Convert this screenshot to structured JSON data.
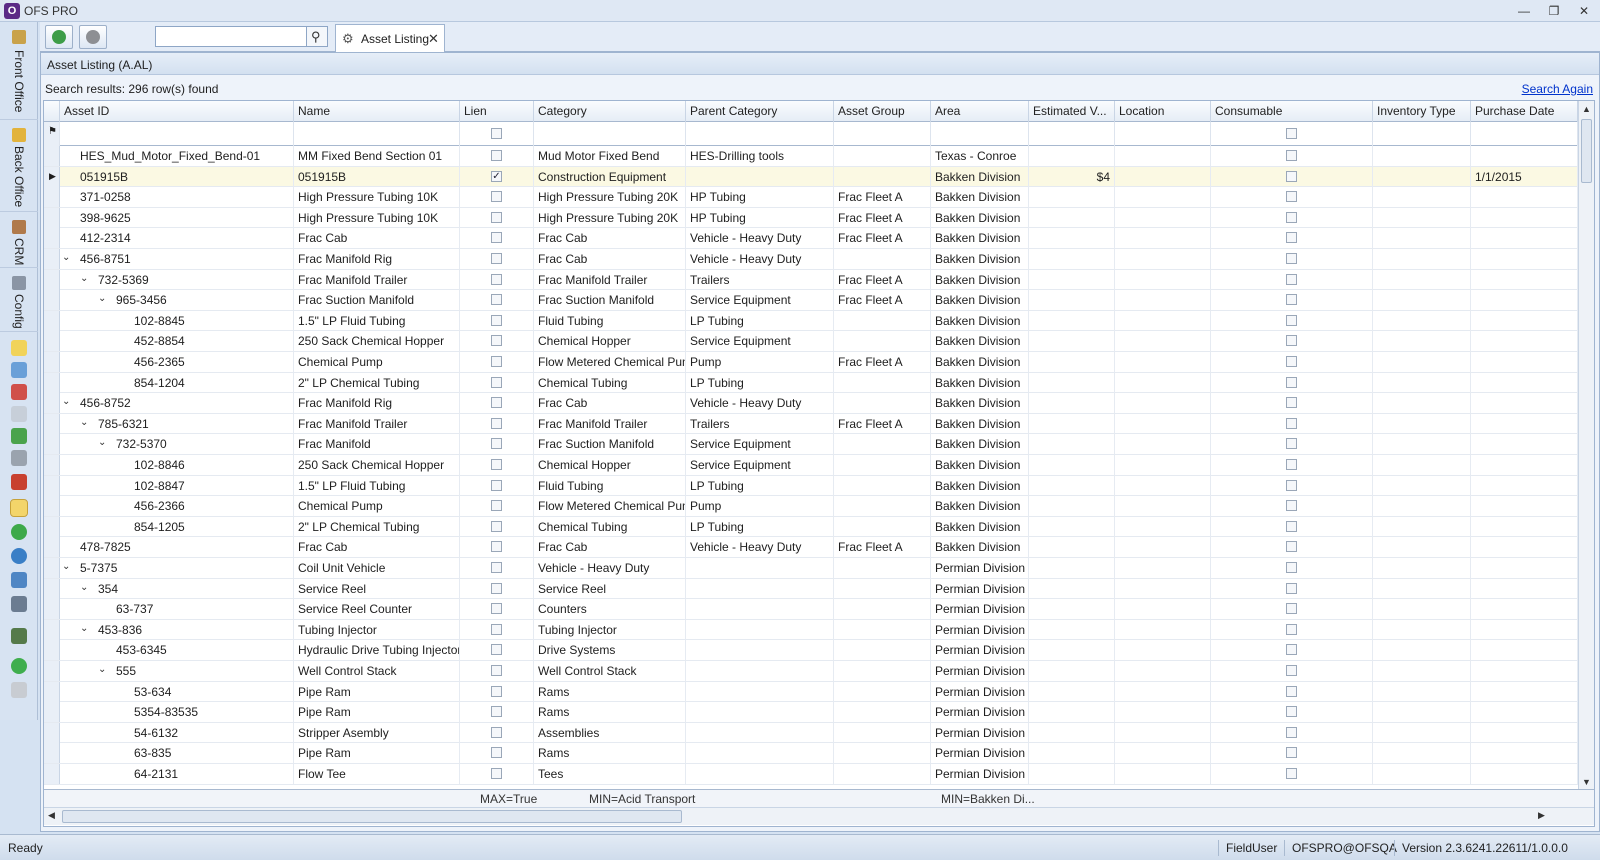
{
  "app": {
    "title": "OFS PRO"
  },
  "toolbar": {
    "search_value": "",
    "tab_label": "Asset Listing"
  },
  "panel": {
    "title": "Asset Listing (A.AL)",
    "results": "Search results: 296 row(s) found",
    "search_again": "Search Again"
  },
  "columns": [
    "Asset ID",
    "Name",
    "Lien",
    "Category",
    "Parent Category",
    "Asset Group",
    "Area",
    "Estimated V...",
    "Location",
    "Consumable",
    "Inventory Type",
    "Purchase Date"
  ],
  "rows": [
    {
      "id": "HES_Mud_Motor_Fixed_Bend-01",
      "lvl": 0,
      "exp": "",
      "name": "MM Fixed Bend Section 01",
      "lien": false,
      "cat": "Mud Motor Fixed Bend",
      "pcat": "HES-Drilling tools",
      "grp": "",
      "area": "Texas - Conroe",
      "est": "",
      "date": ""
    },
    {
      "id": "051915B",
      "lvl": 0,
      "exp": "",
      "name": "051915B",
      "lien": true,
      "cat": "Construction Equipment",
      "pcat": "",
      "grp": "",
      "area": "Bakken Division",
      "est": "$4",
      "date": "1/1/2015",
      "sel": true
    },
    {
      "id": "371-0258",
      "lvl": 0,
      "exp": "",
      "name": "High Pressure Tubing 10K",
      "lien": false,
      "cat": "High Pressure Tubing 20K",
      "pcat": "HP Tubing",
      "grp": "Frac Fleet A",
      "area": "Bakken Division",
      "est": "",
      "date": ""
    },
    {
      "id": "398-9625",
      "lvl": 0,
      "exp": "",
      "name": "High Pressure Tubing 10K",
      "lien": false,
      "cat": "High Pressure Tubing 20K",
      "pcat": "HP Tubing",
      "grp": "Frac Fleet A",
      "area": "Bakken Division",
      "est": "",
      "date": ""
    },
    {
      "id": "412-2314",
      "lvl": 0,
      "exp": "",
      "name": "Frac Cab",
      "lien": false,
      "cat": "Frac Cab",
      "pcat": "Vehicle - Heavy Duty",
      "grp": "Frac Fleet A",
      "area": "Bakken Division",
      "est": "",
      "date": ""
    },
    {
      "id": "456-8751",
      "lvl": 0,
      "exp": "⌄",
      "name": "Frac Manifold Rig",
      "lien": false,
      "cat": "Frac Cab",
      "pcat": "Vehicle - Heavy Duty",
      "grp": "",
      "area": "Bakken Division",
      "est": "",
      "date": ""
    },
    {
      "id": "732-5369",
      "lvl": 1,
      "exp": "⌄",
      "name": "Frac Manifold Trailer",
      "lien": false,
      "cat": "Frac Manifold Trailer",
      "pcat": "Trailers",
      "grp": "Frac Fleet A",
      "area": "Bakken Division",
      "est": "",
      "date": ""
    },
    {
      "id": "965-3456",
      "lvl": 2,
      "exp": "⌄",
      "name": "Frac Suction Manifold",
      "lien": false,
      "cat": "Frac Suction Manifold",
      "pcat": "Service Equipment",
      "grp": "Frac Fleet A",
      "area": "Bakken Division",
      "est": "",
      "date": ""
    },
    {
      "id": "102-8845",
      "lvl": 3,
      "exp": "",
      "name": "1.5\" LP Fluid Tubing",
      "lien": false,
      "cat": "Fluid Tubing",
      "pcat": "LP Tubing",
      "grp": "",
      "area": "Bakken Division",
      "est": "",
      "date": ""
    },
    {
      "id": "452-8854",
      "lvl": 3,
      "exp": "",
      "name": "250 Sack Chemical Hopper",
      "lien": false,
      "cat": "Chemical Hopper",
      "pcat": "Service Equipment",
      "grp": "",
      "area": "Bakken Division",
      "est": "",
      "date": ""
    },
    {
      "id": "456-2365",
      "lvl": 3,
      "exp": "",
      "name": "Chemical Pump",
      "lien": false,
      "cat": "Flow Metered Chemical Pump",
      "pcat": "Pump",
      "grp": "Frac Fleet A",
      "area": "Bakken Division",
      "est": "",
      "date": ""
    },
    {
      "id": "854-1204",
      "lvl": 3,
      "exp": "",
      "name": "2\" LP Chemical Tubing",
      "lien": false,
      "cat": "Chemical Tubing",
      "pcat": "LP Tubing",
      "grp": "",
      "area": "Bakken Division",
      "est": "",
      "date": ""
    },
    {
      "id": "456-8752",
      "lvl": 0,
      "exp": "⌄",
      "name": "Frac Manifold Rig",
      "lien": false,
      "cat": "Frac Cab",
      "pcat": "Vehicle - Heavy Duty",
      "grp": "",
      "area": "Bakken Division",
      "est": "",
      "date": ""
    },
    {
      "id": "785-6321",
      "lvl": 1,
      "exp": "⌄",
      "name": "Frac Manifold Trailer",
      "lien": false,
      "cat": "Frac Manifold Trailer",
      "pcat": "Trailers",
      "grp": "Frac Fleet A",
      "area": "Bakken Division",
      "est": "",
      "date": ""
    },
    {
      "id": "732-5370",
      "lvl": 2,
      "exp": "⌄",
      "name": "Frac Manifold",
      "lien": false,
      "cat": "Frac Suction Manifold",
      "pcat": "Service Equipment",
      "grp": "",
      "area": "Bakken Division",
      "est": "",
      "date": ""
    },
    {
      "id": "102-8846",
      "lvl": 3,
      "exp": "",
      "name": "250 Sack Chemical Hopper",
      "lien": false,
      "cat": "Chemical Hopper",
      "pcat": "Service Equipment",
      "grp": "",
      "area": "Bakken Division",
      "est": "",
      "date": ""
    },
    {
      "id": "102-8847",
      "lvl": 3,
      "exp": "",
      "name": "1.5\" LP Fluid Tubing",
      "lien": false,
      "cat": "Fluid Tubing",
      "pcat": "LP Tubing",
      "grp": "",
      "area": "Bakken Division",
      "est": "",
      "date": ""
    },
    {
      "id": "456-2366",
      "lvl": 3,
      "exp": "",
      "name": "Chemical Pump",
      "lien": false,
      "cat": "Flow Metered Chemical Pump",
      "pcat": "Pump",
      "grp": "",
      "area": "Bakken Division",
      "est": "",
      "date": ""
    },
    {
      "id": "854-1205",
      "lvl": 3,
      "exp": "",
      "name": "2\" LP Chemical Tubing",
      "lien": false,
      "cat": "Chemical Tubing",
      "pcat": "LP Tubing",
      "grp": "",
      "area": "Bakken Division",
      "est": "",
      "date": ""
    },
    {
      "id": "478-7825",
      "lvl": 0,
      "exp": "",
      "name": "Frac Cab",
      "lien": false,
      "cat": "Frac Cab",
      "pcat": "Vehicle - Heavy Duty",
      "grp": "Frac Fleet A",
      "area": "Bakken Division",
      "est": "",
      "date": ""
    },
    {
      "id": "5-7375",
      "lvl": 0,
      "exp": "⌄",
      "name": "Coil Unit Vehicle",
      "lien": false,
      "cat": "Vehicle - Heavy Duty",
      "pcat": "",
      "grp": "",
      "area": "Permian Division",
      "est": "",
      "date": ""
    },
    {
      "id": "354",
      "lvl": 1,
      "exp": "⌄",
      "name": "Service Reel",
      "lien": false,
      "cat": "Service Reel",
      "pcat": "",
      "grp": "",
      "area": "Permian Division",
      "est": "",
      "date": ""
    },
    {
      "id": "63-737",
      "lvl": 2,
      "exp": "",
      "name": "Service Reel Counter",
      "lien": false,
      "cat": "Counters",
      "pcat": "",
      "grp": "",
      "area": "Permian Division",
      "est": "",
      "date": ""
    },
    {
      "id": "453-836",
      "lvl": 1,
      "exp": "⌄",
      "name": "Tubing Injector",
      "lien": false,
      "cat": "Tubing Injector",
      "pcat": "",
      "grp": "",
      "area": "Permian Division",
      "est": "",
      "date": ""
    },
    {
      "id": "453-6345",
      "lvl": 2,
      "exp": "",
      "name": "Hydraulic Drive Tubing Injector",
      "lien": false,
      "cat": "Drive Systems",
      "pcat": "",
      "grp": "",
      "area": "Permian Division",
      "est": "",
      "date": ""
    },
    {
      "id": "555",
      "lvl": 2,
      "exp": "⌄",
      "name": "Well Control Stack",
      "lien": false,
      "cat": "Well Control Stack",
      "pcat": "",
      "grp": "",
      "area": "Permian Division",
      "est": "",
      "date": ""
    },
    {
      "id": "53-634",
      "lvl": 3,
      "exp": "",
      "name": "Pipe Ram",
      "lien": false,
      "cat": "Rams",
      "pcat": "",
      "grp": "",
      "area": "Permian Division",
      "est": "",
      "date": ""
    },
    {
      "id": "5354-83535",
      "lvl": 3,
      "exp": "",
      "name": "Pipe Ram",
      "lien": false,
      "cat": "Rams",
      "pcat": "",
      "grp": "",
      "area": "Permian Division",
      "est": "",
      "date": ""
    },
    {
      "id": "54-6132",
      "lvl": 3,
      "exp": "",
      "name": "Stripper Asembly",
      "lien": false,
      "cat": "Assemblies",
      "pcat": "",
      "grp": "",
      "area": "Permian Division",
      "est": "",
      "date": ""
    },
    {
      "id": "63-835",
      "lvl": 3,
      "exp": "",
      "name": "Pipe Ram",
      "lien": false,
      "cat": "Rams",
      "pcat": "",
      "grp": "",
      "area": "Permian Division",
      "est": "",
      "date": ""
    },
    {
      "id": "64-2131",
      "lvl": 3,
      "exp": "",
      "name": "Flow Tee",
      "lien": false,
      "cat": "Tees",
      "pcat": "",
      "grp": "",
      "area": "Permian Division",
      "est": "",
      "date": ""
    }
  ],
  "footer": {
    "lien": "MAX=True",
    "category": "MIN=Acid Transport",
    "area": "MIN=Bakken Di..."
  },
  "rail": {
    "front_office": "Front Office",
    "back_office": "Back Office",
    "crm": "CRM",
    "config": "Config"
  },
  "status": {
    "left": "Ready",
    "user": "FieldUser",
    "db": "OFSPRO@OFSQA",
    "version": "Version 2.3.6241.22611/1.0.0.0"
  }
}
